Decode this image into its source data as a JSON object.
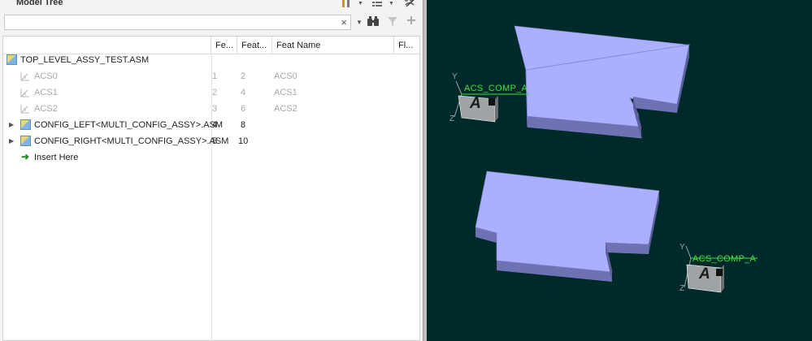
{
  "panel": {
    "title": "Model Tree",
    "search_value": "",
    "search_clear": "×"
  },
  "columns": {
    "feat_num": "Fe...",
    "feat_id": "Feat...",
    "feat_name": "Feat Name",
    "flags": "Fl..."
  },
  "rows": [
    {
      "name": "TOP_LEVEL_ASSY_TEST.ASM",
      "fnum": "",
      "fid": "",
      "fname": "",
      "icon": "assembly-icon",
      "suppressed": false,
      "expandable": false
    },
    {
      "name": "ACS0",
      "fnum": "1",
      "fid": "2",
      "fname": "ACS0",
      "icon": "csys-icon",
      "suppressed": true,
      "expandable": false
    },
    {
      "name": "ACS1",
      "fnum": "2",
      "fid": "4",
      "fname": "ACS1",
      "icon": "csys-icon",
      "suppressed": true,
      "expandable": false
    },
    {
      "name": "ACS2",
      "fnum": "3",
      "fid": "6",
      "fname": "ACS2",
      "icon": "csys-icon",
      "suppressed": true,
      "expandable": false
    },
    {
      "name": "CONFIG_LEFT<MULTI_CONFIG_ASSY>.ASM",
      "fnum": "4",
      "fid": "8",
      "fname": "",
      "icon": "assembly-icon",
      "suppressed": false,
      "expandable": true
    },
    {
      "name": "CONFIG_RIGHT<MULTI_CONFIG_ASSY>.ASM",
      "fnum": "5",
      "fid": "10",
      "fname": "",
      "icon": "assembly-icon",
      "suppressed": false,
      "expandable": true
    },
    {
      "name": "Insert Here",
      "fnum": "",
      "fid": "",
      "fname": "",
      "icon": "insert-arrow-icon",
      "suppressed": false,
      "expandable": false
    }
  ],
  "viewport": {
    "background": "#00292a",
    "part_face_color": "#aab0ff",
    "label_color": "#3fe13f",
    "csys_1": {
      "label": "ACS_COMP_A",
      "axis_y": "Y",
      "axis_z": "Z",
      "glyph": "A"
    },
    "csys_2": {
      "label": "ACS_COMP_A",
      "axis_y": "Y",
      "axis_z": "Z",
      "glyph": "A"
    }
  }
}
